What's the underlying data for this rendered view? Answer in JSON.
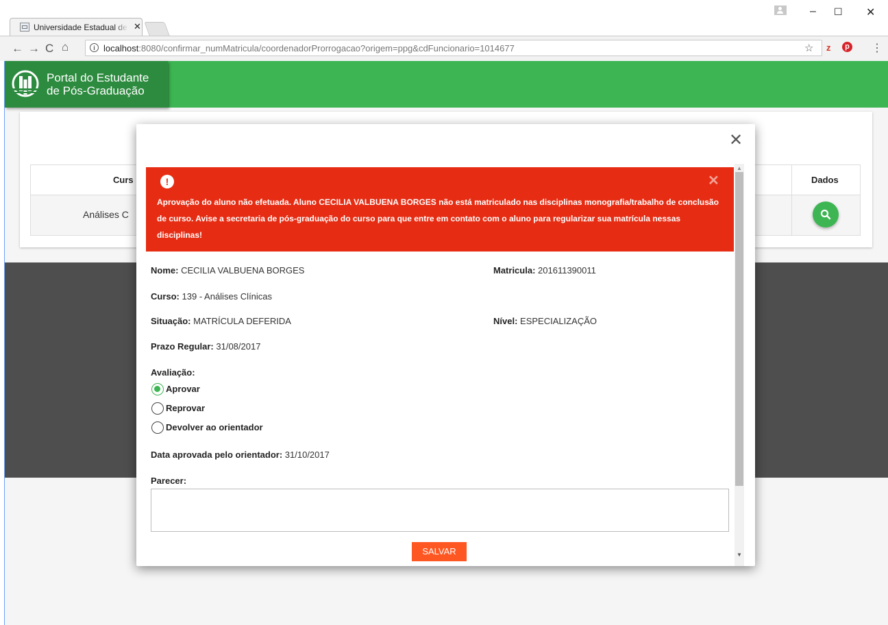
{
  "browser": {
    "tab_title": "Universidade Estadual de Londrina",
    "url_host": "localhost",
    "url_rest": ":8080/confirmar_numMatricula/coordenadorProrrogacao?origem=ppg&cdFuncionario=1014677"
  },
  "app": {
    "brand_line1": "Portal do Estudante",
    "brand_line2": "de Pós-Graduação",
    "green": "#3db553",
    "dark_green": "#2d8b3f"
  },
  "background_table": {
    "column_curso": "Curs",
    "cell_curso": "Análises C",
    "column_dados": "Dados"
  },
  "modal": {
    "alert": {
      "color": "#e62d14",
      "message": "Aprovação do aluno não efetuada. Aluno CECILIA VALBUENA BORGES não está matriculado nas disciplinas monografia/trabalho de conclusão de curso. Avise a secretaria de pós-graduação do curso para que entre em contato com o aluno para regularizar sua matrícula nessas disciplinas!"
    },
    "fields": {
      "nome_label": "Nome:",
      "nome_value": "CECILIA VALBUENA BORGES",
      "matricula_label": "Matricula:",
      "matricula_value": "201611390011",
      "curso_label": "Curso:",
      "curso_value": "139 - Análises Clínicas",
      "situacao_label": "Situação:",
      "situacao_value": "MATRÍCULA DEFERIDA",
      "nivel_label": "Nível:",
      "nivel_value": "ESPECIALIZAÇÃO",
      "prazo_label": "Prazo Regular:",
      "prazo_value": "31/08/2017"
    },
    "avaliacao_label": "Avaliação:",
    "options": [
      {
        "label": "Aprovar",
        "selected": true
      },
      {
        "label": "Reprovar",
        "selected": false
      },
      {
        "label": "Devolver ao orientador",
        "selected": false
      }
    ],
    "data_aprovada_label": "Data aprovada pelo orientador:",
    "data_aprovada_value": "31/10/2017",
    "parecer_label": "Parecer:",
    "parecer_value": "",
    "save_label": "SALVAR",
    "save_color": "#ff5722"
  }
}
